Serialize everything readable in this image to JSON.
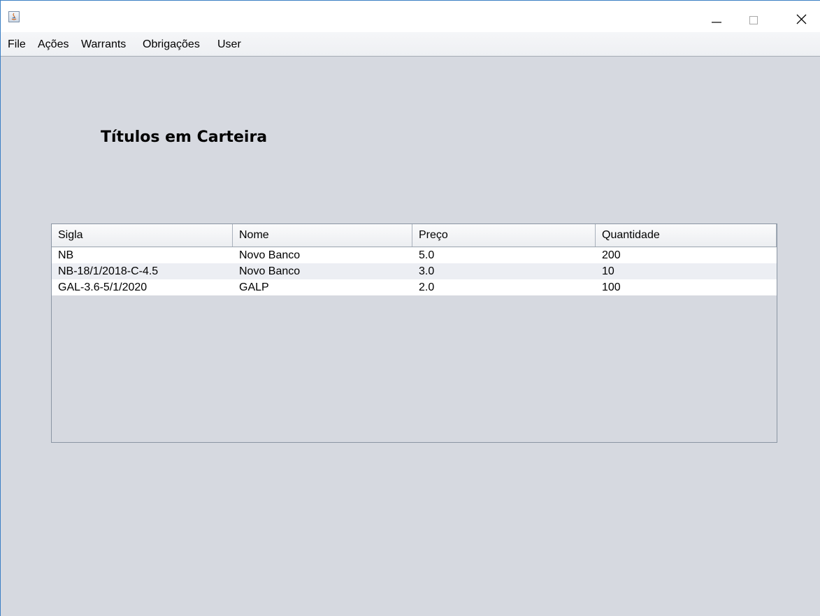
{
  "menu": {
    "items": [
      {
        "label": "File"
      },
      {
        "label": "Ações"
      },
      {
        "label": "Warrants"
      },
      {
        "label": "Obrigações"
      },
      {
        "label": "User"
      }
    ]
  },
  "main": {
    "title": "Títulos em Carteira"
  },
  "table": {
    "columns": [
      "Sigla",
      "Nome",
      "Preço",
      "Quantidade"
    ],
    "rows": [
      [
        "NB",
        "Novo Banco",
        "5.0",
        "200"
      ],
      [
        "NB-18/1/2018-C-4.5",
        "Novo Banco",
        "3.0",
        "10"
      ],
      [
        "GAL-3.6-5/1/2020",
        "GALP",
        "2.0",
        "100"
      ]
    ]
  },
  "icons": {
    "app": "java-app-icon",
    "minimize": "minimize-icon",
    "maximize": "maximize-icon",
    "close": "close-icon"
  },
  "colors": {
    "window_background": "#d6d9e0",
    "window_border": "#3c7fc4",
    "row_odd": "#ffffff",
    "row_even": "#eceef3"
  }
}
